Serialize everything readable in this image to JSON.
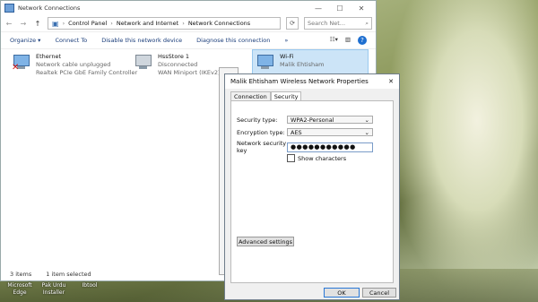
{
  "window": {
    "title": "Network Connections",
    "min": "—",
    "max": "☐",
    "close": "✕"
  },
  "address": {
    "parts": [
      "Control Panel",
      "Network and Internet",
      "Network Connections"
    ],
    "search_placeholder": "Search Net...",
    "back": "←",
    "forward": "→",
    "up": "↑"
  },
  "commands": [
    "Organize ▾",
    "Connect To",
    "Disable this network device",
    "Diagnose this connection",
    "»"
  ],
  "connections": [
    {
      "name": "Ethernet",
      "line1": "Network cable unplugged",
      "line2": "Realtek PCIe GbE Family Controller"
    },
    {
      "name": "HssStore 1",
      "line1": "Disconnected",
      "line2": "WAN Miniport (IKEv2)"
    },
    {
      "name": "Wi-Fi",
      "line1": "Malik Ehtisham",
      "line2": ""
    }
  ],
  "status": {
    "count": "3 items",
    "selected": "1 item selected"
  },
  "dialog": {
    "title": "Malik Ehtisham Wireless Network Properties",
    "close": "✕",
    "tabs": [
      "Connection",
      "Security"
    ],
    "security_type_label": "Security type:",
    "security_type_value": "WPA2-Personal",
    "encryption_label": "Encryption type:",
    "encryption_value": "AES",
    "key_label": "Network security key",
    "key_value": "●●●●●●●●●●●",
    "show_chars": "Show characters",
    "advanced": "Advanced settings",
    "ok": "OK",
    "cancel": "Cancel"
  },
  "desktop": [
    {
      "l1": "Microsoft",
      "l2": "Edge"
    },
    {
      "l1": "Pak Urdu",
      "l2": "Installer"
    },
    {
      "l1": "Ibtool",
      "l2": ""
    }
  ]
}
